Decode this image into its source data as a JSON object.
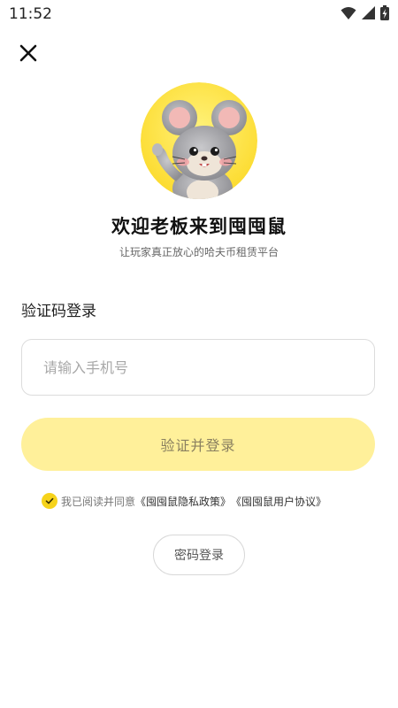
{
  "status_bar": {
    "time": "11:52",
    "icons": [
      "wifi-icon",
      "cell-signal-icon",
      "battery-charging-icon"
    ]
  },
  "header": {
    "close_icon": "close-icon"
  },
  "hero": {
    "avatar": "mouse-mascot",
    "title": "欢迎老板来到囤囤鼠",
    "subtitle": "让玩家真正放心的哈夫币租赁平台"
  },
  "login": {
    "section_label": "验证码登录",
    "phone_placeholder": "请输入手机号",
    "phone_value": "",
    "submit_label": "验证并登录"
  },
  "agreement": {
    "checked": true,
    "prefix": "我已阅读并同意",
    "privacy_link": "《囤囤鼠隐私政策》",
    "user_link": "《囤囤鼠用户协议》"
  },
  "alt_login": {
    "password_label": "密码登录"
  },
  "colors": {
    "accent": "#f6d31b",
    "button_bg": "#fff09a",
    "avatar_bg": "#fde33a"
  }
}
